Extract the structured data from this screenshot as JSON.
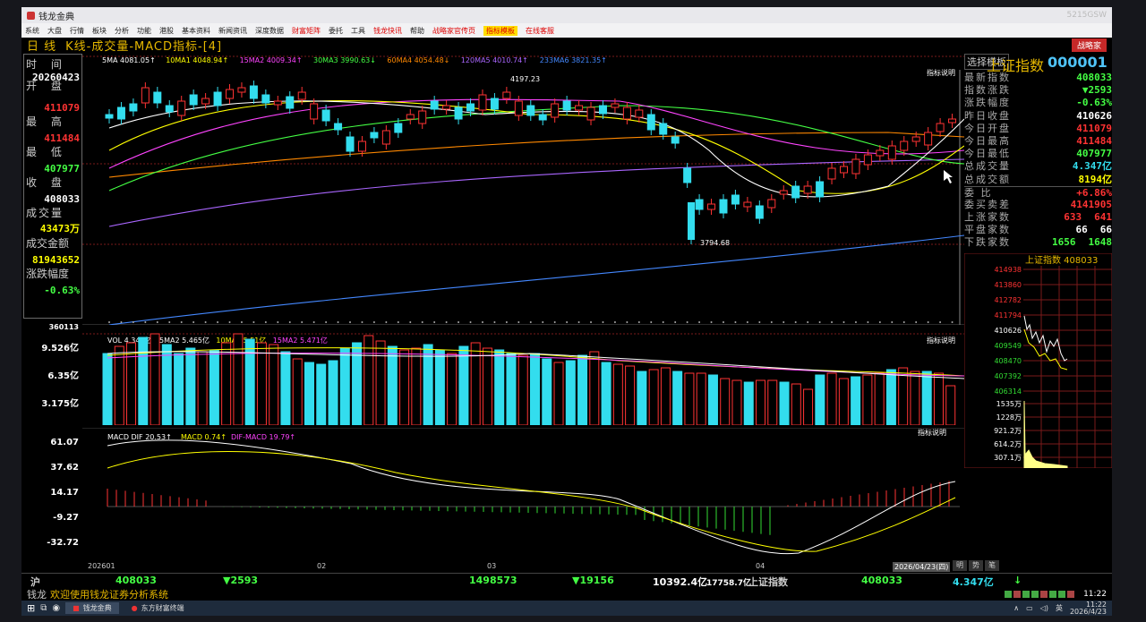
{
  "window": {
    "title": "钱龙金典",
    "corner_text": "5215GSW"
  },
  "menu": {
    "items": [
      "系统",
      "大盘",
      "行情",
      "板块",
      "分析",
      "功能",
      "港股",
      "基本资料",
      "新闻资讯",
      "深度数据",
      "财富矩阵",
      "委托",
      "工具",
      "钱龙快讯",
      "帮助",
      "战略家官传页",
      "指标模板",
      "在线客服"
    ],
    "highlight_indices": [
      10,
      13,
      15,
      17
    ],
    "boxed_index": 16
  },
  "chart_header": {
    "period": "日 线",
    "title": "K线-成交量-MACD指标-[4]",
    "brand": "战略家"
  },
  "left_panel": {
    "time_label": "时 间",
    "time_value": "20260423",
    "open_label": "开 盘",
    "open_value": "411079",
    "high_label": "最 高",
    "high_value": "411484",
    "low_label": "最 低",
    "low_value": "407977",
    "close_label": "收 盘",
    "close_value": "408033",
    "vol_label": "成交量",
    "vol_value": "43473万",
    "amt_label": "成交金额",
    "amt_value": "81943652",
    "chg_label": "涨跌幅度",
    "chg_value": "-0.63%"
  },
  "ma_legend": [
    {
      "text": "5MA 4081.05↑",
      "color": "#ffffff"
    },
    {
      "text": "10MA1 4048.94↑",
      "color": "#ffff00"
    },
    {
      "text": "15MA2 4009.34↑",
      "color": "#ff44ff"
    },
    {
      "text": "30MA3 3990.63↓",
      "color": "#44ff44"
    },
    {
      "text": "60MA4 4054.48↓",
      "color": "#ff8800"
    },
    {
      "text": "120MA5 4010.74↑",
      "color": "#aa66ff"
    },
    {
      "text": "233MA6 3821.35↑",
      "color": "#4488ff"
    }
  ],
  "main_chart": {
    "high_mark": "4197.23",
    "low_mark": "3794.68",
    "template_button": "选择模板",
    "indicator_note": "指标说明",
    "axis_top": "360113"
  },
  "colors": {
    "up": "#ff3333",
    "down": "#33ddee",
    "text_yellow": "#e6b800",
    "neg": "#33dd33"
  },
  "volume": {
    "legend": [
      {
        "text": "VOL 4.347亿",
        "color": "#ffffff"
      },
      {
        "text": "5MA2 5.465亿",
        "color": "#ffffff"
      },
      {
        "text": "10MA1 5.51亿",
        "color": "#ffff00"
      },
      {
        "text": "15MA2 5.471亿",
        "color": "#ff44ff"
      }
    ],
    "axis": [
      "9.526亿",
      "6.35亿",
      "3.175亿"
    ],
    "note": "指标说明"
  },
  "macd": {
    "legend": [
      {
        "text": "MACD DIF 20.53↑",
        "color": "#ffffff"
      },
      {
        "text": "MACD 0.74↑",
        "color": "#ffff00"
      },
      {
        "text": "DIF-MACD 19.79↑",
        "color": "#ff44ff"
      }
    ],
    "axis": [
      "61.07",
      "37.62",
      "14.17",
      "-9.27",
      "-32.72"
    ],
    "note": "指标说明"
  },
  "dates": {
    "labels": [
      "202601",
      "02",
      "03",
      "04"
    ],
    "cursor_date": "2026/04/23(四)"
  },
  "right_panel": {
    "name": "上证指数",
    "code": "000001",
    "rows": [
      {
        "label": "最新指数",
        "value": "408033",
        "color": "#44ff44"
      },
      {
        "label": "指数涨跌",
        "value": "▼2593",
        "color": "#44ff44"
      },
      {
        "label": "涨跌幅度",
        "value": "-0.63%",
        "color": "#44ff44"
      },
      {
        "label": "昨日收盘",
        "value": "410626",
        "color": "#ffffff"
      },
      {
        "label": "今日开盘",
        "value": "411079",
        "color": "#ff3333"
      },
      {
        "label": "今日最高",
        "value": "411484",
        "color": "#ff3333"
      },
      {
        "label": "今日最低",
        "value": "407977",
        "color": "#44ff44"
      },
      {
        "label": "总成交量",
        "value": "4.347亿",
        "color": "#33ddee"
      },
      {
        "label": "总成交额",
        "value": "8194亿",
        "color": "#ffff00"
      }
    ],
    "ratio_label": "委 比",
    "ratio_value": "+6.86%",
    "diff_label": "委买卖差",
    "diff_value": "4141905",
    "up_label": "上涨家数",
    "up_a": "633",
    "up_b": "641",
    "flat_label": "平盘家数",
    "flat_a": "66",
    "flat_b": "66",
    "down_label": "下跌家数",
    "down_a": "1656",
    "down_b": "1648"
  },
  "mini_chart": {
    "title": "上证指数 408033",
    "price_axis": [
      "414938",
      "413860",
      "412782",
      "411794",
      "410626",
      "409549",
      "408470",
      "407392",
      "406314"
    ],
    "vol_axis": [
      "1535万",
      "1228万",
      "921.2万",
      "614.2万",
      "307.1万"
    ]
  },
  "bottom_bar": {
    "market": "沪",
    "index": "408033",
    "change": "▼2593",
    "amount": "1498573",
    "change2": "▼19156",
    "amt_total": "10392.4亿",
    "amt_sub": "17758.7亿",
    "idx_name": "上证指数",
    "idx_value": "408033",
    "vol": "4.347亿",
    "arrow": "↓"
  },
  "tab_row": [
    "明",
    "势",
    "笔"
  ],
  "status": {
    "app": "钱龙",
    "message": "欢迎使用钱龙证券分析系统",
    "time": "11:22"
  },
  "taskbar": {
    "app1": "钱龙金典",
    "app2": "东方财富终端",
    "ime": "英",
    "clock_time": "11:22",
    "clock_date": "2026/4/23"
  }
}
